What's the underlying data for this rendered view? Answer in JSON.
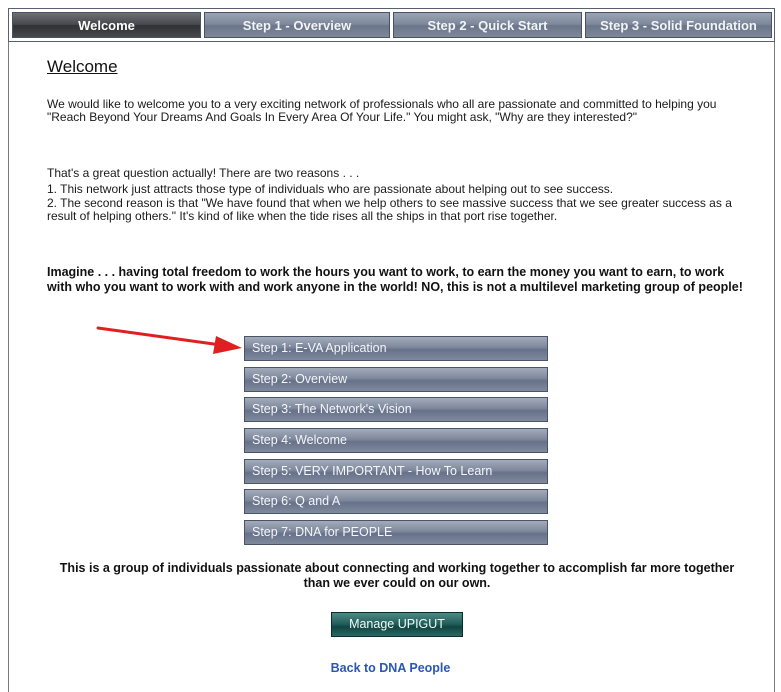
{
  "tabs": [
    {
      "label": "Welcome",
      "active": true
    },
    {
      "label": "Step 1 - Overview",
      "active": false
    },
    {
      "label": "Step 2 - Quick Start",
      "active": false
    },
    {
      "label": "Step 3 - Solid Foundation",
      "active": false
    }
  ],
  "page_title": "Welcome",
  "intro": "We would like to welcome you to a very exciting network of professionals who all are passionate and committed to helping you \"Reach Beyond Your Dreams And Goals In Every Area Of Your Life.\"  You might ask, \"Why are they interested?\"",
  "question": "That's a great question actually!  There are two reasons . . .",
  "reason_1": "1. This network just attracts those type of individuals who are passionate about helping out to see success.",
  "reason_2": "2. The second reason is that \"We have found that when we help others to see massive success that we see greater success as a result of helping others.\"  It's kind of like when the tide rises all the ships in that port rise together.",
  "imagine": "Imagine . . . having total freedom to work the hours you want to work, to earn the money you want to earn, to work with who you want to work with and work anyone in the world!  NO, this is not a multilevel marketing group of people!",
  "steps": [
    {
      "label": "Step 1: E-VA Application"
    },
    {
      "label": "Step 2: Overview"
    },
    {
      "label": "Step 3: The Network's Vision"
    },
    {
      "label": "Step 4: Welcome"
    },
    {
      "label": "Step 5: VERY IMPORTANT - How To Learn"
    },
    {
      "label": "Step 6: Q and A"
    },
    {
      "label": "Step 7: DNA for PEOPLE"
    }
  ],
  "closing": "This is a group of individuals passionate about connecting and working together to accomplish far more together than we ever could on our own.",
  "manage_button": "Manage UPIGUT",
  "back_link": "Back to DNA People",
  "colors": {
    "tab_active": "#46484c",
    "tab_inactive": "#7c879a",
    "step_button": "#7e889b",
    "manage_button": "#1f5c58",
    "link": "#2a57b3",
    "arrow": "#e02020"
  }
}
